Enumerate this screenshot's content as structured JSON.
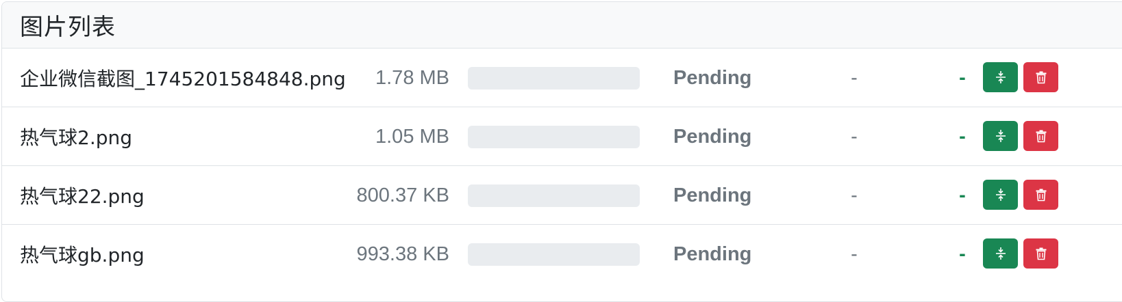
{
  "header": {
    "title": "图片列表"
  },
  "files": [
    {
      "name": "企业微信截图_1745201584848.png",
      "size": "1.78 MB",
      "progress": 0,
      "status": "Pending",
      "result": "-",
      "saving": "-"
    },
    {
      "name": "热气球2.png",
      "size": "1.05 MB",
      "progress": 0,
      "status": "Pending",
      "result": "-",
      "saving": "-"
    },
    {
      "name": "热气球22.png",
      "size": "800.37 KB",
      "progress": 0,
      "status": "Pending",
      "result": "-",
      "saving": "-"
    },
    {
      "name": "热气球gb.png",
      "size": "993.38 KB",
      "progress": 0,
      "status": "Pending",
      "result": "-",
      "saving": "-"
    }
  ],
  "icons": {
    "compress": "compress-icon",
    "delete": "trash-icon"
  },
  "colors": {
    "compress_button": "#198754",
    "delete_button": "#dc3545",
    "saving_text": "#198754",
    "status_text": "#6c757d",
    "progress_track": "#e9ecef"
  }
}
